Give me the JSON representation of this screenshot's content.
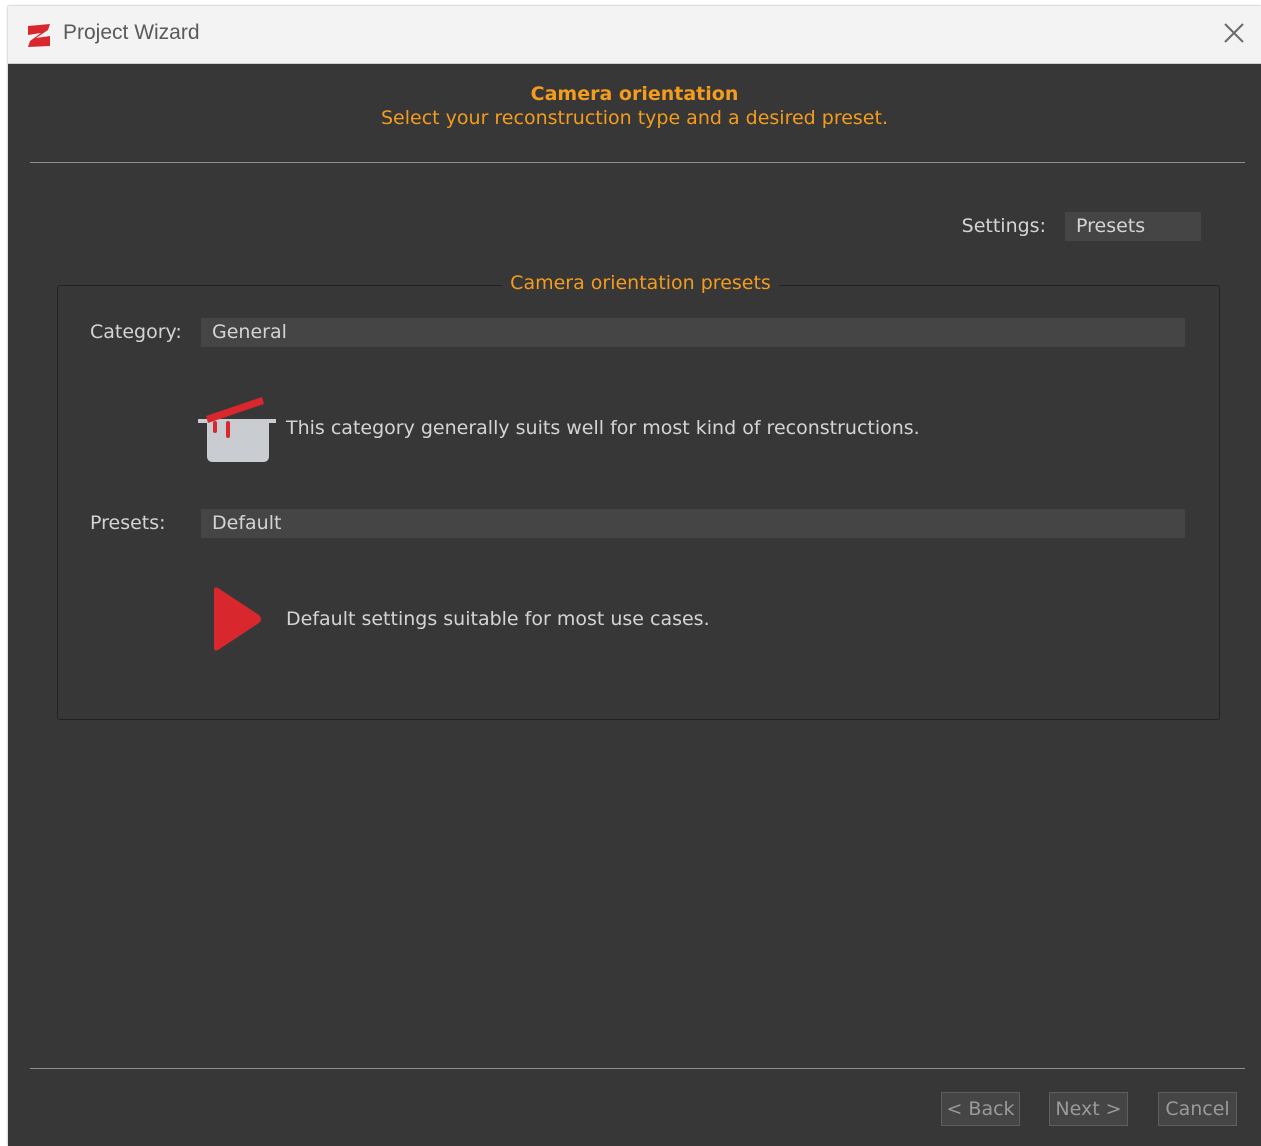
{
  "window": {
    "title": "Project Wizard"
  },
  "header": {
    "title": "Camera orientation",
    "subtitle": "Select your reconstruction type and a desired preset."
  },
  "settings": {
    "label": "Settings:",
    "value": "Presets"
  },
  "group": {
    "title": "Camera orientation presets",
    "category": {
      "label": "Category:",
      "value": "General",
      "description": "This category generally suits well for most kind of reconstructions.",
      "icon": "pot-icon"
    },
    "presets": {
      "label": "Presets:",
      "value": "Default",
      "description": "Default settings suitable for most use cases.",
      "icon": "play-icon"
    }
  },
  "buttons": {
    "back": "< Back",
    "next": "Next >",
    "cancel": "Cancel"
  },
  "colors": {
    "accent": "#f39c1f",
    "brand_red": "#d9272e",
    "background": "#373737"
  }
}
